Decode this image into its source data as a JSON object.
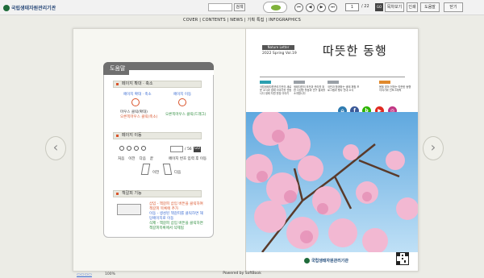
{
  "topbar": {
    "logo_text": "국립생태자원관리기관",
    "search_button": "검색",
    "page_current": "1",
    "page_total": "/ 22",
    "go_label": "GO",
    "buttons": [
      "목차보기",
      "인쇄",
      "도움말",
      "닫기"
    ]
  },
  "menu": {
    "items": [
      "COVER",
      "CONTENTS",
      "NEWS",
      "기획 특집",
      "INFOGRAPHICS"
    ],
    "separator": " | "
  },
  "help": {
    "title": "도움말",
    "sections": [
      {
        "title": "페이지 확대 · 축소",
        "items": [
          {
            "label": "페이지 확대 · 축소",
            "text1": "마우스 클릭(확대)",
            "text2": "오른쪽마우스 클릭(축소)"
          },
          {
            "label": "페이지 이동",
            "text1": "오른쪽마우스 클릭(드래그)"
          }
        ]
      },
      {
        "title": "페이지 이동",
        "page_total": "/ 56",
        "go_label": "GO",
        "nav_labels": [
          "처음",
          "이전",
          "다음",
          "끝"
        ],
        "page_field_label": "페이지 번호 입력 후 이동",
        "next_label": "이전",
        "next2_label": "다음"
      },
      {
        "title": "책갈피 기능",
        "lines": [
          "삽입 - 책갈피 삽입 버튼을 클릭하여 책갈피 목록에 추가",
          "이동 - 생성된 책갈피를 클릭하면 해당페이지로 이동",
          "삭제 - 책갈피 삽입 버튼을 클릭하면 책갈피목록에서 삭제됨"
        ]
      }
    ]
  },
  "magazine": {
    "tagline": "Nature Letter",
    "issue": "2022 Spring Vol.19",
    "title": "따뜻한 동행",
    "columns": [
      {
        "color": "#2a9fb0",
        "text": "국립생태자원관리기관의 새로운 소식과 생태 이야기를 전합니다 생태 자원 현장 이야기"
      },
      {
        "color": "#9aa0a6",
        "text": "생태자원의 보전과 관리를 위한 다양한 활동과 연구 결과를 소개합니다"
      },
      {
        "color": "#9aa0a6",
        "text": "국민과 함께하는 생태 체험 프로그램과 행사 안내 소식"
      },
      {
        "color": "#e0892c",
        "text": "봄을 맞아 전하는 따뜻한 동행 이야기와 인포그래픽"
      }
    ],
    "social": [
      {
        "name": "home",
        "color": "#2f7bb0",
        "glyph": "⌂"
      },
      {
        "name": "facebook",
        "color": "#3b5998",
        "glyph": "f"
      },
      {
        "name": "blog",
        "color": "#2db400",
        "glyph": "b"
      },
      {
        "name": "youtube",
        "color": "#e02a20",
        "glyph": "▶"
      },
      {
        "name": "instagram",
        "color": "#c13584",
        "glyph": "◎"
      }
    ],
    "footer_logo": "국립생태자원관리기관"
  },
  "footer": {
    "powered": "Powered by SoftBook",
    "zoom": "100%"
  }
}
